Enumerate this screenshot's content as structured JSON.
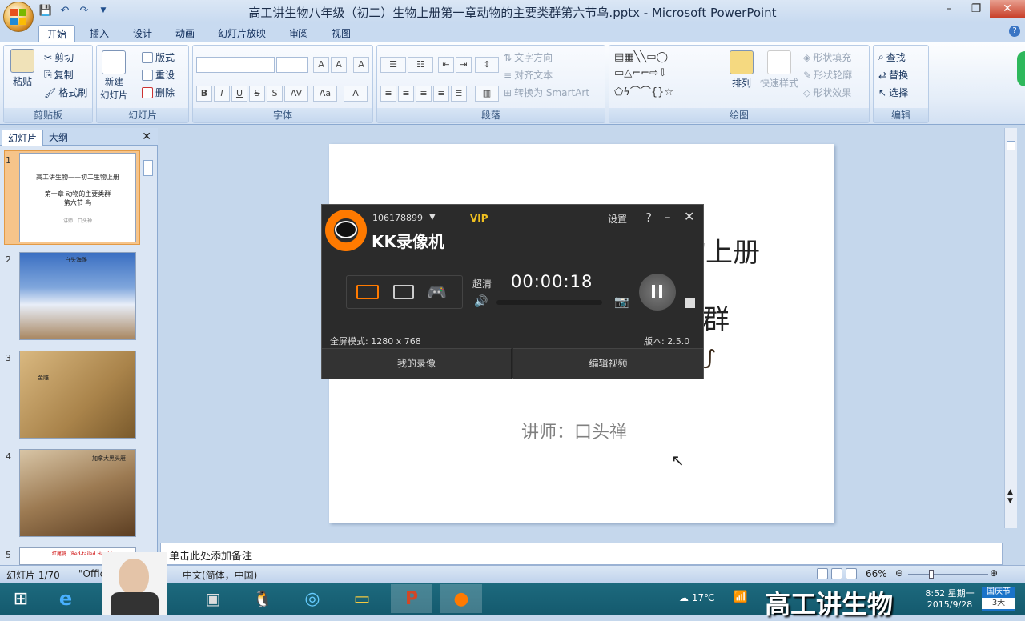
{
  "window": {
    "title": "高工讲生物八年级（初二）生物上册第一章动物的主要类群第六节鸟.pptx - Microsoft PowerPoint"
  },
  "ribbon_tabs": [
    "开始",
    "插入",
    "设计",
    "动画",
    "幻灯片放映",
    "审阅",
    "视图"
  ],
  "ribbon": {
    "clipboard": {
      "paste": "粘贴",
      "cut": "剪切",
      "copy": "复制",
      "format_painter": "格式刷",
      "label": "剪贴板"
    },
    "slides": {
      "new_slide_1": "新建",
      "new_slide_2": "幻灯片",
      "layout": "版式",
      "reset": "重设",
      "delete": "删除",
      "label": "幻灯片"
    },
    "font": {
      "label": "字体"
    },
    "paragraph": {
      "text_direction": "文字方向",
      "align_text": "对齐文本",
      "smartart": "转换为 SmartArt",
      "label": "段落"
    },
    "drawing": {
      "arrange": "排列",
      "quick_styles": "快速样式",
      "shape_fill": "形状填充",
      "shape_outline": "形状轮廓",
      "shape_effects": "形状效果",
      "label": "绘图"
    },
    "editing": {
      "find": "查找",
      "replace": "替换",
      "select": "选择",
      "label": "编辑"
    }
  },
  "panel": {
    "tab_slides": "幻灯片",
    "tab_outline": "大纲",
    "thumbs": [
      {
        "num": "1",
        "title": "高工讲生物——初二生物上册",
        "sub": "第一章 动物的主要类群",
        "sub2": "第六节 鸟",
        "lecturer": "讲师：口头禅"
      },
      {
        "num": "2",
        "caption": "白头海雕"
      },
      {
        "num": "3",
        "caption": "金雕"
      },
      {
        "num": "4",
        "caption": "加拿大黑头雁"
      },
      {
        "num": "5",
        "caption": "红尾鸲（Red-tailed Hawk）"
      }
    ]
  },
  "slide": {
    "title_partial": "物上册",
    "sub_partial": "群",
    "lecturer": "讲师：口头禅"
  },
  "notes": {
    "placeholder": "单击此处添加备注"
  },
  "status": {
    "slide": "幻灯片 1/70",
    "theme": "\"Offic",
    "lang": "中文(简体，中国)",
    "zoom": "66%"
  },
  "kk": {
    "account": "106178899",
    "vip": "VIP",
    "settings": "设置",
    "help": "?",
    "brand": "KK录像机",
    "quality": "超清",
    "timer": "00:00:18",
    "mode": "全屏模式: 1280 x 768",
    "version": "版本: 2.5.0",
    "my_recordings": "我的录像",
    "edit_video": "编辑视频"
  },
  "taskbar": {
    "weather": "17℃",
    "clock_time": "8:52 星期一",
    "clock_date": "2015/9/28",
    "holiday": "国庆节",
    "holiday_days": "3天",
    "watermark": "高工讲生物"
  },
  "colors": {
    "ribbon": "#dbe7f5",
    "kk_bg": "#2b2b2b",
    "kk_orange": "#ff7a00",
    "taskbar": "#1d6a7e"
  }
}
